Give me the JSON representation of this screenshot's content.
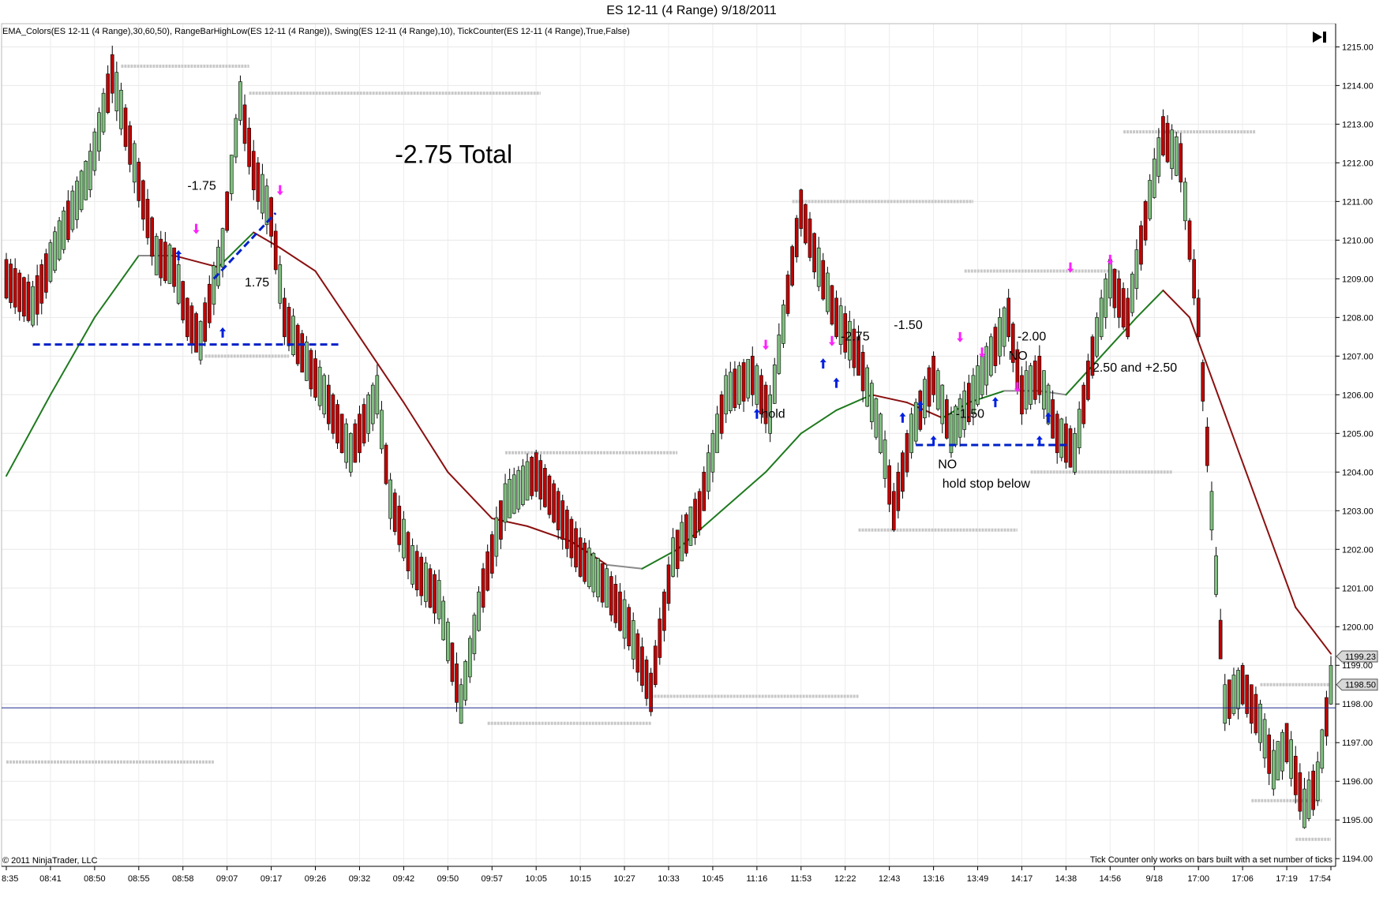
{
  "window": {
    "title": "ES 12-11 (4 Range)  9/18/2011"
  },
  "indicators_line": "EMA_Colors(ES 12-11 (4 Range),30,60,50), RangeBarHighLow(ES 12-11 (4 Range)), Swing(ES 12-11 (4 Range),10), TickCounter(ES 12-11 (4 Range),True,False)",
  "copyright": "© 2011 NinjaTrader, LLC",
  "footer_note": "Tick Counter only works on bars built with a set number of ticks",
  "last_bar_button_icon": "skip-to-end-icon",
  "colors": {
    "up_candle": "#7fbf7f",
    "down_candle": "#c00000",
    "ema_up": "#1e7a1e",
    "ema_flat": "#8a8a8a",
    "ema_down": "#8b1010",
    "swing_marks": "#c8c8c8",
    "trendline": "#0020c8",
    "arrow_up": "#0020e0",
    "arrow_down": "#ff20ff",
    "hline": "#1c2a8c"
  },
  "chart_data": {
    "type": "candlestick",
    "title": "ES 12-11 (4 Range)  9/18/2011",
    "ylim": [
      1193.8,
      1215.6
    ],
    "y_ticks": [
      "1215.00",
      "1214.00",
      "1213.00",
      "1212.00",
      "1211.00",
      "1210.00",
      "1209.00",
      "1208.00",
      "1207.00",
      "1206.00",
      "1205.00",
      "1204.00",
      "1203.00",
      "1202.00",
      "1201.00",
      "1200.00",
      "1199.00",
      "1198.00",
      "1197.00",
      "1196.00",
      "1195.00",
      "1194.00"
    ],
    "x_ticks": [
      "8:35",
      "08:41",
      "08:50",
      "08:55",
      "08:58",
      "09:07",
      "09:17",
      "09:26",
      "09:32",
      "09:42",
      "09:50",
      "09:57",
      "10:05",
      "10:15",
      "10:27",
      "10:33",
      "10:45",
      "11:16",
      "11:53",
      "12:22",
      "12:43",
      "13:16",
      "13:49",
      "14:17",
      "14:38",
      "14:56",
      "9/18",
      "17:00",
      "17:06",
      "17:19",
      "17:54"
    ],
    "price_labels": [
      {
        "text": "1199.23",
        "value": 1199.23
      },
      {
        "text": "1198.50",
        "value": 1198.5
      }
    ],
    "horizontal_line": 1197.9,
    "price_path": [
      [
        0,
        1209.0
      ],
      [
        6,
        1208.3
      ],
      [
        12,
        1210.0
      ],
      [
        19,
        1211.8
      ],
      [
        24,
        1214.3
      ],
      [
        29,
        1212.0
      ],
      [
        34,
        1209.6
      ],
      [
        38,
        1209.3
      ],
      [
        41,
        1208.0
      ],
      [
        44,
        1207.4
      ],
      [
        49,
        1209.8
      ],
      [
        53,
        1213.6
      ],
      [
        56,
        1211.8
      ],
      [
        60,
        1210.6
      ],
      [
        63,
        1208.0
      ],
      [
        66,
        1207.3
      ],
      [
        72,
        1206.0
      ],
      [
        78,
        1204.5
      ],
      [
        84,
        1206.0
      ],
      [
        87,
        1203.3
      ],
      [
        92,
        1201.6
      ],
      [
        98,
        1200.7
      ],
      [
        103,
        1198.0
      ],
      [
        108,
        1201.0
      ],
      [
        113,
        1203.2
      ],
      [
        120,
        1204.0
      ],
      [
        125,
        1203.0
      ],
      [
        130,
        1201.8
      ],
      [
        136,
        1201.0
      ],
      [
        141,
        1200.0
      ],
      [
        146,
        1198.3
      ],
      [
        151,
        1201.8
      ],
      [
        157,
        1203.0
      ],
      [
        163,
        1206.0
      ],
      [
        169,
        1206.5
      ],
      [
        173,
        1205.5
      ],
      [
        177,
        1208.6
      ],
      [
        180,
        1210.8
      ],
      [
        184,
        1209.3
      ],
      [
        188,
        1208.0
      ],
      [
        193,
        1207.0
      ],
      [
        198,
        1205.0
      ],
      [
        201,
        1203.0
      ],
      [
        205,
        1205.0
      ],
      [
        210,
        1206.5
      ],
      [
        214,
        1205.0
      ],
      [
        219,
        1206.0
      ],
      [
        223,
        1207.0
      ],
      [
        227,
        1208.0
      ],
      [
        230,
        1206.0
      ],
      [
        234,
        1206.5
      ],
      [
        238,
        1205.0
      ],
      [
        242,
        1204.5
      ],
      [
        246,
        1207.0
      ],
      [
        250,
        1209.0
      ],
      [
        254,
        1208.0
      ],
      [
        258,
        1210.5
      ],
      [
        262,
        1212.7
      ],
      [
        266,
        1212.0
      ],
      [
        270,
        1208.0
      ],
      [
        273,
        1203.0
      ],
      [
        276,
        1198.0
      ],
      [
        280,
        1198.5
      ],
      [
        284,
        1197.5
      ],
      [
        287,
        1196.3
      ],
      [
        290,
        1197.0
      ],
      [
        294,
        1195.3
      ],
      [
        297,
        1196.0
      ],
      [
        300,
        1198.5
      ]
    ],
    "ema_points": [
      [
        0,
        1203.9
      ],
      [
        10,
        1206.0
      ],
      [
        20,
        1208.0
      ],
      [
        30,
        1209.6
      ],
      [
        38,
        1209.6
      ],
      [
        48,
        1209.3
      ],
      [
        56,
        1210.2
      ],
      [
        62,
        1209.8
      ],
      [
        70,
        1209.2
      ],
      [
        80,
        1207.5
      ],
      [
        90,
        1205.8
      ],
      [
        100,
        1204.0
      ],
      [
        110,
        1202.8
      ],
      [
        118,
        1202.6
      ],
      [
        128,
        1202.2
      ],
      [
        136,
        1201.6
      ],
      [
        144,
        1201.5
      ],
      [
        152,
        1202.0
      ],
      [
        162,
        1203.0
      ],
      [
        172,
        1204.0
      ],
      [
        180,
        1205.0
      ],
      [
        188,
        1205.6
      ],
      [
        196,
        1206.0
      ],
      [
        204,
        1205.8
      ],
      [
        212,
        1205.4
      ],
      [
        218,
        1205.8
      ],
      [
        226,
        1206.1
      ],
      [
        234,
        1206.1
      ],
      [
        240,
        1206.0
      ],
      [
        248,
        1207.0
      ],
      [
        256,
        1208.0
      ],
      [
        262,
        1208.7
      ],
      [
        268,
        1208.0
      ],
      [
        276,
        1205.5
      ],
      [
        284,
        1203.0
      ],
      [
        292,
        1200.5
      ],
      [
        300,
        1199.3
      ]
    ],
    "swing_levels": [
      {
        "x0": 26,
        "x1": 55,
        "value": 1214.5
      },
      {
        "x0": 55,
        "x1": 121,
        "value": 1213.8
      },
      {
        "x0": 45,
        "x1": 64,
        "value": 1207.0
      },
      {
        "x0": 113,
        "x1": 152,
        "value": 1204.5
      },
      {
        "x0": 178,
        "x1": 219,
        "value": 1211.0
      },
      {
        "x0": 109,
        "x1": 146,
        "value": 1197.5
      },
      {
        "x0": 146,
        "x1": 193,
        "value": 1198.2
      },
      {
        "x0": 193,
        "x1": 229,
        "value": 1202.5
      },
      {
        "x0": 217,
        "x1": 252,
        "value": 1209.2
      },
      {
        "x0": 232,
        "x1": 264,
        "value": 1204.0
      },
      {
        "x0": 253,
        "x1": 283,
        "value": 1212.8
      },
      {
        "x0": 0,
        "x1": 47,
        "value": 1196.5
      },
      {
        "x0": 282,
        "x1": 298,
        "value": 1195.5
      },
      {
        "x0": 284,
        "x1": 300,
        "value": 1198.5
      },
      {
        "x0": 292,
        "x1": 300,
        "value": 1194.5
      }
    ],
    "trendlines": [
      {
        "x0": 6,
        "v0": 1207.3,
        "x1": 76,
        "v1": 1207.3
      },
      {
        "x0": 47,
        "v0": 1209.0,
        "x1": 61,
        "v1": 1210.7
      },
      {
        "x0": 206,
        "v0": 1204.7,
        "x1": 241,
        "v1": 1204.7
      }
    ],
    "annotations": [
      {
        "text": "-2.75 Total",
        "x": 88,
        "value": 1212.0,
        "size": "big"
      },
      {
        "text": "-1.75",
        "x": 41,
        "value": 1211.3
      },
      {
        "text": "1.75",
        "x": 54,
        "value": 1208.8
      },
      {
        "text": "hold",
        "x": 171,
        "value": 1205.4
      },
      {
        "text": "-2.75",
        "x": 189,
        "value": 1207.4
      },
      {
        "text": "-1.50",
        "x": 201,
        "value": 1207.7
      },
      {
        "text": "-2.00",
        "x": 229,
        "value": 1207.4
      },
      {
        "text": "NO",
        "x": 227,
        "value": 1206.9
      },
      {
        "text": "-1.50",
        "x": 215,
        "value": 1205.4
      },
      {
        "text": "NO",
        "x": 211,
        "value": 1204.1
      },
      {
        "text": "hold stop below",
        "x": 212,
        "value": 1203.6
      },
      {
        "text": "2.50 and +2.50",
        "x": 246,
        "value": 1206.6
      }
    ],
    "up_arrows": [
      [
        39,
        1209.6
      ],
      [
        49,
        1207.6
      ],
      [
        170,
        1205.5
      ],
      [
        185,
        1206.8
      ],
      [
        188,
        1206.3
      ],
      [
        203,
        1205.4
      ],
      [
        207,
        1205.7
      ],
      [
        210,
        1204.8
      ],
      [
        224,
        1205.8
      ],
      [
        236,
        1205.4
      ],
      [
        234,
        1204.8
      ]
    ],
    "down_arrows": [
      [
        43,
        1210.3
      ],
      [
        62,
        1211.3
      ],
      [
        172,
        1207.3
      ],
      [
        187,
        1207.4
      ],
      [
        216,
        1207.5
      ],
      [
        221,
        1207.1
      ],
      [
        229,
        1206.2
      ],
      [
        241,
        1209.3
      ],
      [
        250,
        1209.5
      ]
    ]
  }
}
